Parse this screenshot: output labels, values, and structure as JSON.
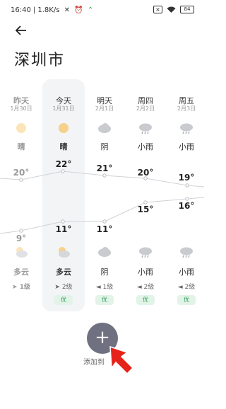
{
  "status": {
    "time": "16:40",
    "speed": "1.8K/s",
    "battery": "84"
  },
  "city": "深圳市",
  "days": [
    {
      "name": "昨天",
      "date": "1月30日",
      "cond_day": "晴",
      "icon_day": "sun-icon",
      "hi": "20°",
      "lo": "9°",
      "icon_night": "cloudy-icon",
      "cond_night": "多云",
      "wind": "1级",
      "aqi": ""
    },
    {
      "name": "今天",
      "date": "1月31日",
      "cond_day": "晴",
      "icon_day": "sun-icon",
      "hi": "22°",
      "lo": "11°",
      "icon_night": "cloudy-icon",
      "cond_night": "多云",
      "wind": "2级",
      "aqi": "优"
    },
    {
      "name": "明天",
      "date": "2月1日",
      "cond_day": "阴",
      "icon_day": "overcast-icon",
      "hi": "21°",
      "lo": "11°",
      "icon_night": "overcast-icon",
      "cond_night": "阴",
      "wind": "1级",
      "aqi": "优"
    },
    {
      "name": "周四",
      "date": "2月2日",
      "cond_day": "小雨",
      "icon_day": "light-rain-icon",
      "hi": "20°",
      "lo": "15°",
      "icon_night": "light-rain-icon",
      "cond_night": "小雨",
      "wind": "2级",
      "aqi": "优"
    },
    {
      "name": "周五",
      "date": "2月3日",
      "cond_day": "小雨",
      "icon_day": "light-rain-icon",
      "hi": "19°",
      "lo": "16°",
      "icon_night": "light-rain-icon",
      "cond_night": "小雨",
      "wind": "2级",
      "aqi": "优"
    }
  ],
  "add_label": "添加到",
  "add_symbol": "+",
  "colors": {
    "accent_green": "#2e9b58",
    "button": "#6f7180",
    "arrow": "#e5231b"
  }
}
